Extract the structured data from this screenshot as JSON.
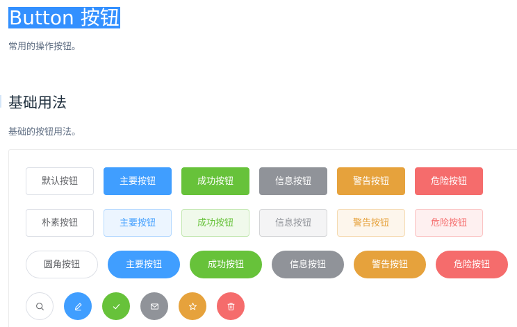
{
  "header": {
    "title": "Button 按钮",
    "description": "常用的操作按钮。"
  },
  "section": {
    "title": "基础用法",
    "description": "基础的按钮用法。"
  },
  "rows": {
    "default": [
      "默认按钮",
      "主要按钮",
      "成功按钮",
      "信息按钮",
      "警告按钮",
      "危险按钮"
    ],
    "plain": [
      "朴素按钮",
      "主要按钮",
      "成功按钮",
      "信息按钮",
      "警告按钮",
      "危险按钮"
    ],
    "round": [
      "圆角按钮",
      "主要按钮",
      "成功按钮",
      "信息按钮",
      "警告按钮",
      "危险按钮"
    ],
    "circle_icons": [
      "search-icon",
      "edit-icon",
      "check-icon",
      "message-icon",
      "star-icon",
      "delete-icon"
    ]
  },
  "colors": {
    "primary": "#409eff",
    "success": "#67c23a",
    "info": "#909399",
    "warning": "#e6a23c",
    "danger": "#f56c6c",
    "title_highlight": "#3390ff"
  }
}
